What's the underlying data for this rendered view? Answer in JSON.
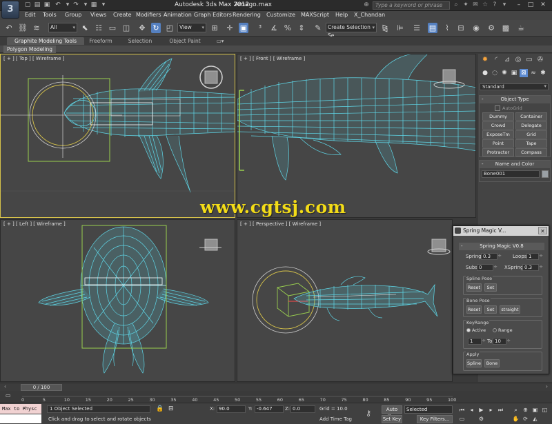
{
  "window": {
    "app_title": "Autodesk 3ds Max  2012",
    "file_name": "Amago.max",
    "search_placeholder": "Type a keyword or phrase"
  },
  "menu": [
    "Edit",
    "Tools",
    "Group",
    "Views",
    "Create",
    "Modifiers",
    "Animation",
    "Graph Editors",
    "Rendering",
    "Customize",
    "MAXScript",
    "Help",
    "X_Chandan"
  ],
  "toolbar": {
    "selection_filter": "All",
    "reference_coord": "View",
    "named_selection": "Create Selection Se"
  },
  "ribbon": {
    "tabs": [
      "Graphite Modeling Tools",
      "Freeform",
      "Selection",
      "Object Paint"
    ],
    "active_panel": "Polygon Modeling"
  },
  "viewports": {
    "top": "[ + ] [ Top ] [ Wireframe ]",
    "front": "[ + ] [ Front ] [ Wireframe ]",
    "left": "[ + ] [ Left ] [ Wireframe ]",
    "perspective": "[ + ] [ Perspective ] [ Wireframe ]",
    "wire_color": "#5fd7e8",
    "active_border_color": "#d7c34a"
  },
  "watermark": "www.cgtsj.com",
  "command_panel": {
    "category": "Standard",
    "object_type_title": "Object Type",
    "autogrid": "AutoGrid",
    "buttons": [
      "Dummy",
      "Container",
      "Crowd",
      "Delegate",
      "ExposeTm",
      "Grid",
      "Point",
      "Tape",
      "Protractor",
      "Compass"
    ],
    "name_color_title": "Name and Color",
    "object_name": "Bone001"
  },
  "spring_magic": {
    "window_title": "Spring Magic V...",
    "rollout_title": "Spring Magic V0.8",
    "spring_label": "Spring",
    "spring_value": "0.3",
    "loops_label": "Loops",
    "loops_value": "1",
    "subs_label": "Subs",
    "subs_value": "0",
    "xspring_label": "XSpring",
    "xspring_value": "0.3",
    "spline_pose_label": "Spline Pose",
    "reset_label": "Reset",
    "set_label": "Set",
    "bone_pose_label": "Bone Pose",
    "straight_label": "straight",
    "key_range_label": "KeyRange",
    "active_label": "Active",
    "range_label": "Range",
    "range_from": "1",
    "to_label": "To",
    "range_to": "10",
    "apply_label": "Apply",
    "spline_label": "Spline",
    "bone_label": "Bone"
  },
  "timeline": {
    "frame_display": "0 / 100",
    "ticks": [
      "0",
      "5",
      "10",
      "15",
      "20",
      "25",
      "30",
      "35",
      "40",
      "45",
      "50",
      "55",
      "60",
      "65",
      "70",
      "75",
      "80",
      "85",
      "90",
      "95",
      "100"
    ]
  },
  "status": {
    "maxscript": "Max to Physc",
    "selection": "1 Object Selected",
    "prompt": "Click and drag to select and rotate objects",
    "x_label": "X:",
    "x_value": "90.0",
    "y_label": "Y:",
    "y_value": "-0.647",
    "z_label": "Z:",
    "z_value": "0.0",
    "grid": "Grid = 10.0",
    "add_time_tag": "Add Time Tag",
    "auto_key": "Auto Key",
    "set_key": "Set Key",
    "key_mode": "Selected",
    "key_filters": "Key Filters..."
  }
}
